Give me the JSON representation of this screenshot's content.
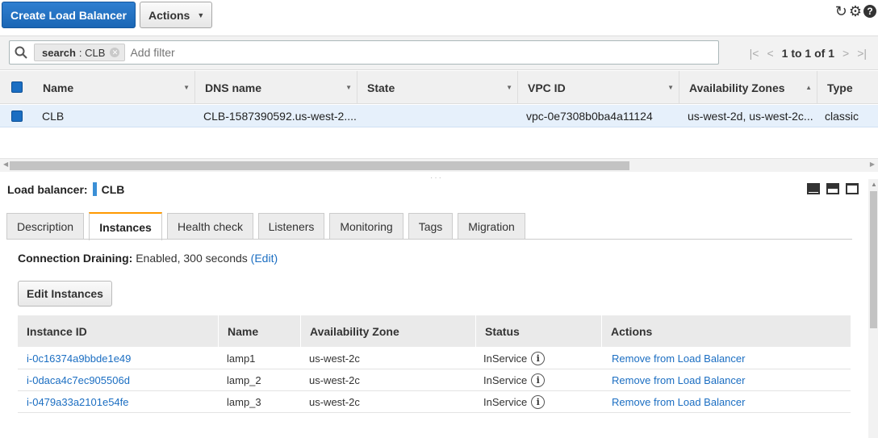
{
  "toolbar": {
    "create_label": "Create Load Balancer",
    "actions_label": "Actions"
  },
  "filter": {
    "token_key": "search",
    "token_value": "CLB",
    "placeholder": "Add filter",
    "pagination": "1 to 1 of 1"
  },
  "table": {
    "columns": [
      "Name",
      "DNS name",
      "State",
      "VPC ID",
      "Availability Zones",
      "Type"
    ],
    "rows": [
      {
        "name": "CLB",
        "dns": "CLB-1587390592.us-west-2....",
        "state": "",
        "vpc": "vpc-0e7308b0ba4a11124",
        "zones": "us-west-2d, us-west-2c...",
        "type": "classic"
      }
    ]
  },
  "detail": {
    "label": "Load balancer:",
    "name": "CLB",
    "tabs": [
      "Description",
      "Instances",
      "Health check",
      "Listeners",
      "Monitoring",
      "Tags",
      "Migration"
    ],
    "active_tab": "Instances",
    "draining_label": "Connection Draining:",
    "draining_value": "Enabled, 300 seconds",
    "draining_edit": "(Edit)",
    "edit_instances_label": "Edit Instances",
    "instance_columns": [
      "Instance ID",
      "Name",
      "Availability Zone",
      "Status",
      "Actions"
    ],
    "instances": [
      {
        "id": "i-0c16374a9bbde1e49",
        "name": "lamp1",
        "zone": "us-west-2c",
        "status": "InService",
        "action": "Remove from Load Balancer"
      },
      {
        "id": "i-0daca4c7ec905506d",
        "name": "lamp_2",
        "zone": "us-west-2c",
        "status": "InService",
        "action": "Remove from Load Balancer"
      },
      {
        "id": "i-0479a33a2101e54fe",
        "name": "lamp_3",
        "zone": "us-west-2c",
        "status": "InService",
        "action": "Remove from Load Balancer"
      }
    ]
  },
  "icons": {
    "refresh": "refresh-icon",
    "settings": "gear-icon",
    "help": "help-icon",
    "accent": "#1b6ec2",
    "tab_accent": "#ff9900"
  }
}
